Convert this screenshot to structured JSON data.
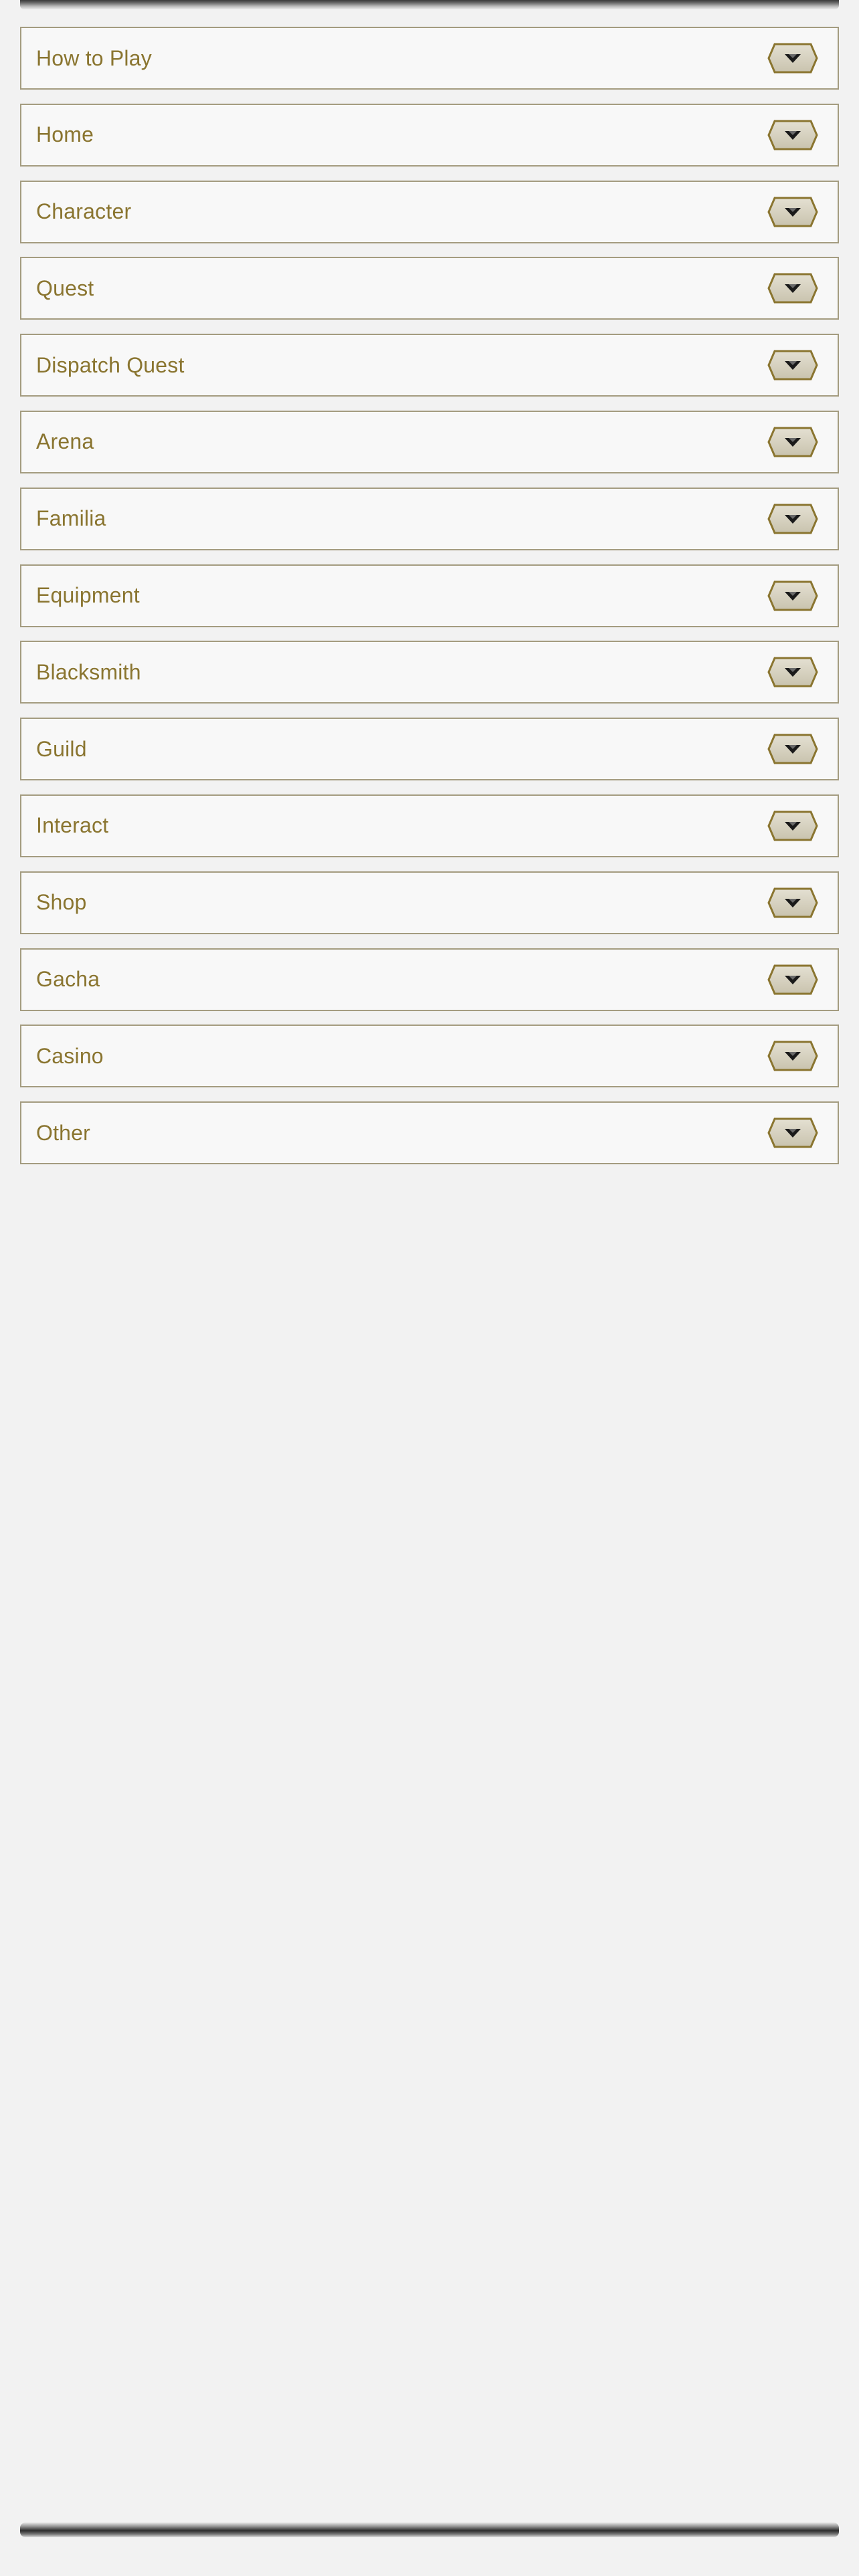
{
  "menu": {
    "items": [
      {
        "label": "How to Play",
        "icon": "chevron-down-icon"
      },
      {
        "label": "Home",
        "icon": "chevron-down-icon"
      },
      {
        "label": "Character",
        "icon": "chevron-down-icon"
      },
      {
        "label": "Quest",
        "icon": "chevron-down-icon"
      },
      {
        "label": "Dispatch Quest",
        "icon": "chevron-down-icon"
      },
      {
        "label": "Arena",
        "icon": "chevron-down-icon"
      },
      {
        "label": "Familia",
        "icon": "chevron-down-icon"
      },
      {
        "label": "Equipment",
        "icon": "chevron-down-icon"
      },
      {
        "label": "Blacksmith",
        "icon": "chevron-down-icon"
      },
      {
        "label": "Guild",
        "icon": "chevron-down-icon"
      },
      {
        "label": "Interact",
        "icon": "chevron-down-icon"
      },
      {
        "label": "Shop",
        "icon": "chevron-down-icon"
      },
      {
        "label": "Gacha",
        "icon": "chevron-down-icon"
      },
      {
        "label": "Casino",
        "icon": "chevron-down-icon"
      },
      {
        "label": "Other",
        "icon": "chevron-down-icon"
      }
    ]
  },
  "colors": {
    "label": "#8a7530",
    "item_border": "#a49c80",
    "item_background": "#f8f8f8",
    "button_border": "#8a7530",
    "button_fill": "#c9c3ae",
    "arrow": "#1a1a1a",
    "page_background": "#f2f2f2"
  }
}
